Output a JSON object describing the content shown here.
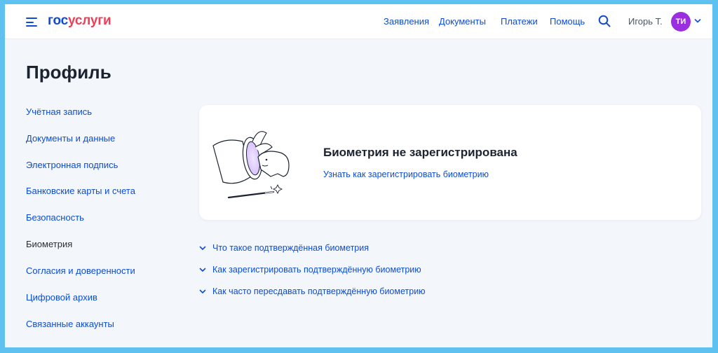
{
  "header": {
    "logo_part1": "гос",
    "logo_part2": "услуги",
    "nav": [
      "Заявления",
      "Документы",
      "Платежи",
      "Помощь"
    ],
    "user_name": "Игорь Т.",
    "avatar_initials": "ТИ",
    "icons": {
      "menu": "hamburger-icon",
      "search": "search-icon",
      "dropdown": "chevron-down-icon"
    }
  },
  "page": {
    "title": "Профиль"
  },
  "sidebar": {
    "items": [
      {
        "label": "Учётная запись"
      },
      {
        "label": "Документы и данные"
      },
      {
        "label": "Электронная подпись"
      },
      {
        "label": "Банковские карты и счета"
      },
      {
        "label": "Безопасность"
      },
      {
        "label": "Биометрия",
        "active": true
      },
      {
        "label": "Согласия и доверенности"
      },
      {
        "label": "Цифровой архив"
      },
      {
        "label": "Связанные аккаунты"
      }
    ]
  },
  "card": {
    "illustration": "magic-hat-rabbit-illustration",
    "title": "Биометрия не зарегистрирована",
    "link": "Узнать как зарегистрировать биометрию"
  },
  "faq": [
    {
      "label": "Что такое подтверждённая биометрия"
    },
    {
      "label": "Как зарегистрировать подтверждённую биометрию"
    },
    {
      "label": "Как часто пересдавать подтверждённую биометрию"
    }
  ],
  "colors": {
    "accent": "#0d4cd3",
    "brand_red": "#ee3f58",
    "avatar": "#9b2fe0",
    "page_bg": "#f3f6fb",
    "outer_border": "#5ec1f0"
  }
}
